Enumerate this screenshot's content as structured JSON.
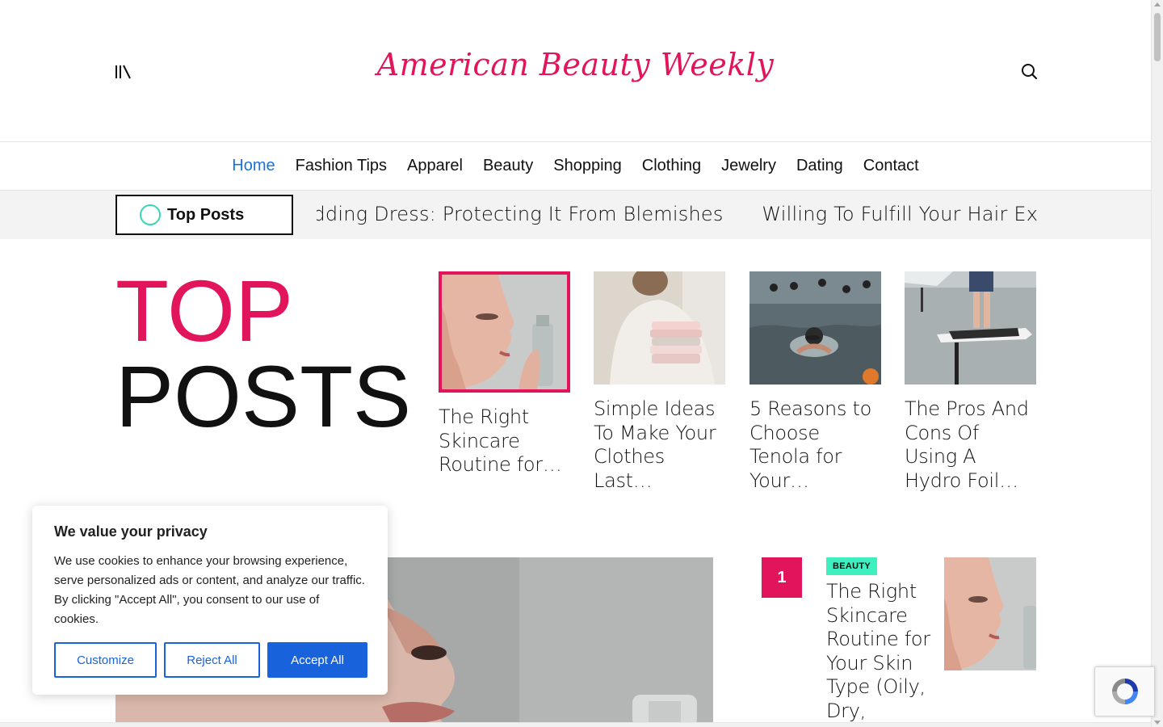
{
  "site": {
    "logo": "American Beauty Weekly"
  },
  "nav": {
    "items": [
      {
        "label": "Home",
        "active": true
      },
      {
        "label": "Fashion Tips"
      },
      {
        "label": "Apparel"
      },
      {
        "label": "Beauty"
      },
      {
        "label": "Shopping"
      },
      {
        "label": "Clothing"
      },
      {
        "label": "Jewelry"
      },
      {
        "label": "Dating"
      },
      {
        "label": "Contact"
      }
    ]
  },
  "ticker": {
    "label": "Top Posts",
    "items": [
      "Wedding Dress: Protecting It From Blemishes",
      "Willing To Fulfill Your Hair Extension De"
    ]
  },
  "top_posts": {
    "title_line1": "TOP",
    "title_line2": "POSTS",
    "cards": [
      {
        "title": "The Right Skincare Routine for…",
        "image": "woman-skincare-serum",
        "active": true
      },
      {
        "title": "Simple Ideas To Make Your Clothes Last…",
        "image": "man-folded-clothes"
      },
      {
        "title": "5 Reasons to Choose Tenola for Your…",
        "image": "swimmers-open-water"
      },
      {
        "title": "The Pros And Cons Of Using A Hydro Foil…",
        "image": "hydrofoil-board"
      }
    ]
  },
  "feature": {
    "image": "woman-skincare-closeup"
  },
  "ranked_list": {
    "rank": "1",
    "category": "BEAUTY",
    "title": "The Right Skincare Routine for Your Skin Type (Oily, Dry,",
    "image": "woman-skincare-serum"
  },
  "cookie": {
    "title": "We value your privacy",
    "text": "We use cookies to enhance your browsing experience, serve personalized ads or content, and analyze our traffic. By clicking \"Accept All\", you consent to our use of cookies.",
    "customize": "Customize",
    "reject": "Reject All",
    "accept": "Accept All"
  },
  "colors": {
    "brand": "#e2145b",
    "nav_active": "#1a73d9",
    "badge": "#3ef0c0",
    "cookie_blue": "#1863dc"
  }
}
